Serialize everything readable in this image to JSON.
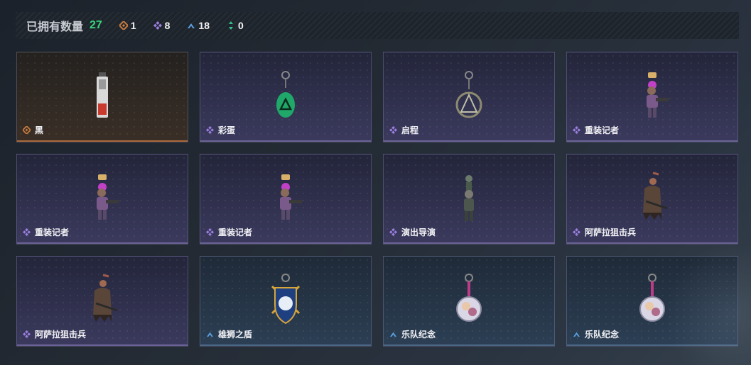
{
  "summary": {
    "owned_label": "已拥有数量",
    "owned_count": "27",
    "rarities": [
      {
        "icon": "orange-diamond-icon",
        "color": "#c47a3e",
        "count": "1"
      },
      {
        "icon": "purple-diamond-icon",
        "color": "#9b7fe0",
        "count": "8"
      },
      {
        "icon": "blue-chevron-icon",
        "color": "#5aa0e0",
        "count": "18"
      },
      {
        "icon": "green-arrows-icon",
        "color": "#33c28a",
        "count": "0"
      }
    ]
  },
  "items": [
    {
      "name": "黑",
      "rarity": "orange",
      "icon": "orange-diamond-icon",
      "art": "black-pendant-icon"
    },
    {
      "name": "彩蛋",
      "rarity": "purple",
      "icon": "purple-diamond-icon",
      "art": "green-egg-pendant-icon"
    },
    {
      "name": "启程",
      "rarity": "purple",
      "icon": "purple-diamond-icon",
      "art": "mountain-pendant-icon"
    },
    {
      "name": "重装记者",
      "rarity": "purple",
      "icon": "purple-diamond-icon",
      "art": "heavy-reporter-figure-icon"
    },
    {
      "name": "重装记者",
      "rarity": "purple",
      "icon": "purple-diamond-icon",
      "art": "heavy-reporter-figure-icon"
    },
    {
      "name": "重装记者",
      "rarity": "purple",
      "icon": "purple-diamond-icon",
      "art": "heavy-reporter-figure-icon"
    },
    {
      "name": "演出导演",
      "rarity": "purple",
      "icon": "purple-diamond-icon",
      "art": "director-figure-icon"
    },
    {
      "name": "阿萨拉狙击兵",
      "rarity": "purple",
      "icon": "purple-diamond-icon",
      "art": "sniper-figure-icon"
    },
    {
      "name": "阿萨拉狙击兵",
      "rarity": "purple",
      "icon": "purple-diamond-icon",
      "art": "sniper-figure-icon"
    },
    {
      "name": "雄狮之盾",
      "rarity": "blue",
      "icon": "blue-chevron-icon",
      "art": "lion-shield-pendant-icon"
    },
    {
      "name": "乐队纪念",
      "rarity": "blue",
      "icon": "blue-chevron-icon",
      "art": "band-badge-pendant-icon"
    },
    {
      "name": "乐队纪念",
      "rarity": "blue",
      "icon": "blue-chevron-icon",
      "art": "band-badge-pendant-icon"
    }
  ]
}
